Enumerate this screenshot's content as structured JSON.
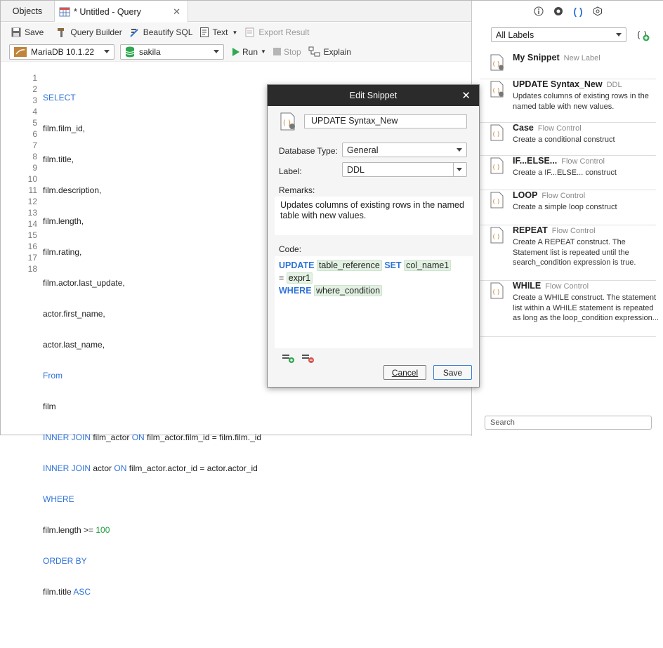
{
  "tabs": {
    "objects": "Objects",
    "query": "* Untitled - Query"
  },
  "toolbar": {
    "save": "Save",
    "query_builder": "Query Builder",
    "beautify": "Beautify SQL",
    "text": "Text",
    "export": "Export Result"
  },
  "toolbar2": {
    "connection": "MariaDB 10.1.22",
    "database": "sakila",
    "run": "Run",
    "stop": "Stop",
    "explain": "Explain"
  },
  "editor": {
    "line_numbers": [
      "1",
      "2",
      "3",
      "4",
      "5",
      "6",
      "7",
      "8",
      "9",
      "10",
      "11",
      "12",
      "13",
      "14",
      "15",
      "16",
      "17",
      "18"
    ]
  },
  "dialog": {
    "title": "Edit Snippet",
    "name": "UPDATE Syntax_New",
    "database_type_label": "Database Type:",
    "database_type": "General",
    "label_label": "Label:",
    "label": "DDL",
    "remarks_label": "Remarks:",
    "remarks": "Updates columns of existing rows in the named table with new values.",
    "code_label": "Code:",
    "code": {
      "update": "UPDATE",
      "table_reference": "table_reference",
      "set": "SET",
      "col_name1": "col_name1",
      "eq": "=",
      "expr1": "expr1",
      "where": "WHERE",
      "where_condition": "where_condition"
    },
    "cancel": "Cancel",
    "save": "Save"
  },
  "right_panel": {
    "filter": "All Labels",
    "search_placeholder": "Search",
    "snippets": [
      {
        "title": "My Snippet",
        "label": "New Label",
        "desc": ""
      },
      {
        "title": "UPDATE Syntax_New",
        "label": "DDL",
        "desc": "Updates columns of existing rows in the named table with new values."
      },
      {
        "title": "Case",
        "label": "Flow Control",
        "desc": "Create a conditional construct"
      },
      {
        "title": "IF...ELSE...",
        "label": "Flow Control",
        "desc": "Create a IF...ELSE... construct"
      },
      {
        "title": "LOOP",
        "label": "Flow Control",
        "desc": "Create a simple loop construct"
      },
      {
        "title": "REPEAT",
        "label": "Flow Control",
        "desc": "Create A REPEAT construct. The Statement list is repeated until the search_condition expression is true."
      },
      {
        "title": "WHILE",
        "label": "Flow Control",
        "desc": "Create a WHILE construct. The statement list within a WHILE statement is repeated as long as the loop_condition expression..."
      }
    ]
  },
  "colors": {
    "keyword": "#2f73d8",
    "number": "#1e9c3c",
    "dialog_title_bg": "#2b2b2b",
    "snippet_icon": "#c9822b"
  }
}
